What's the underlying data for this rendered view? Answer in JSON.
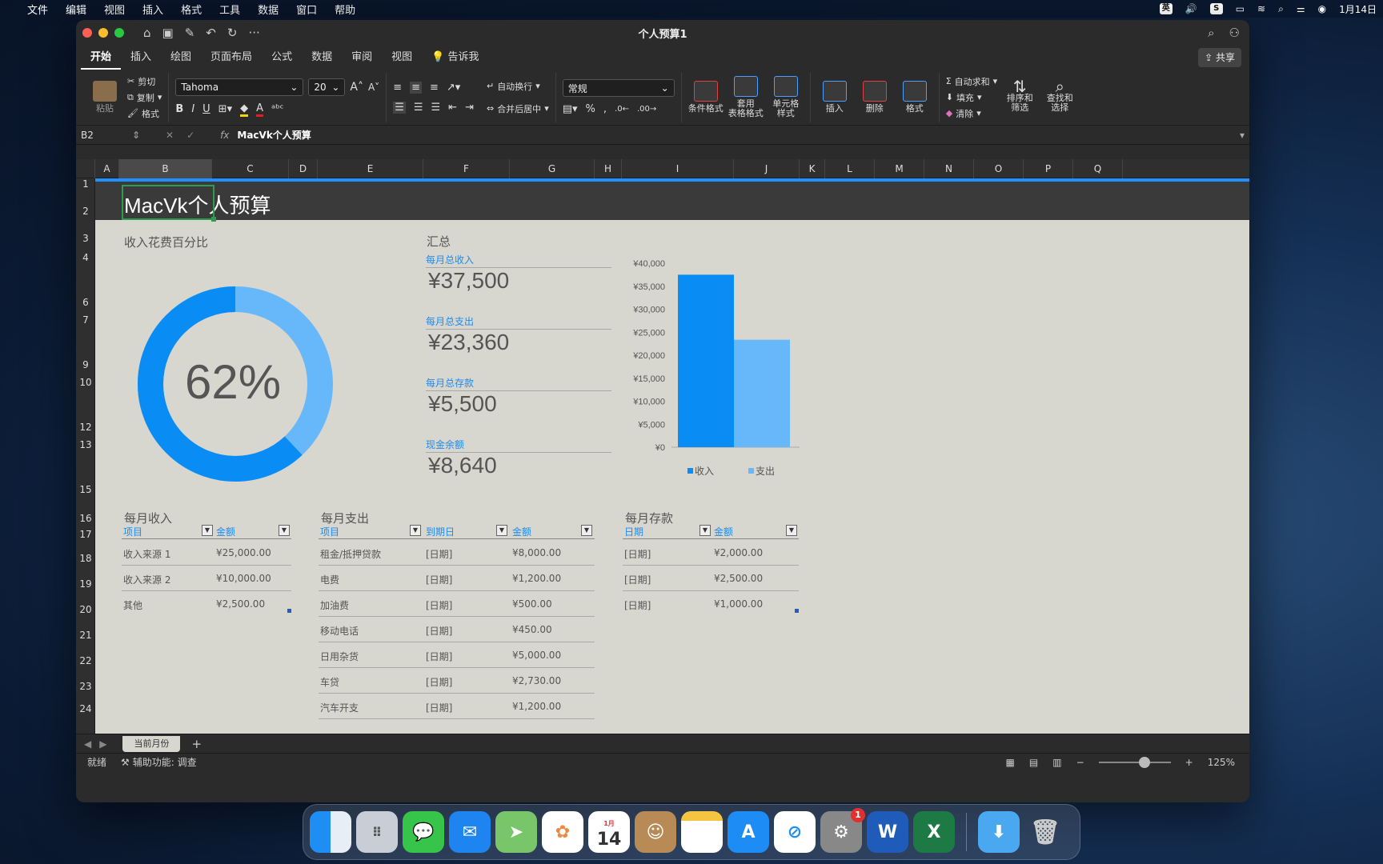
{
  "menubar": {
    "items": [
      "文件",
      "编辑",
      "视图",
      "插入",
      "格式",
      "工具",
      "数据",
      "窗口",
      "帮助"
    ],
    "input_method": "英",
    "date": "1月14日"
  },
  "window": {
    "title": "个人预算1"
  },
  "tabs": [
    "开始",
    "插入",
    "绘图",
    "页面布局",
    "公式",
    "数据",
    "审阅",
    "视图"
  ],
  "tell_me": "告诉我",
  "share": "共享",
  "ribbon": {
    "paste": "粘贴",
    "cut": "剪切",
    "copy": "复制",
    "format_painter": "格式",
    "font": "Tahoma",
    "size": "20",
    "wrap": "自动换行",
    "merge": "合并后居中",
    "number_format": "常规",
    "cond_format": "条件格式",
    "table_format": "套用\n表格格式",
    "cell_style": "单元格\n样式",
    "insert": "插入",
    "delete": "删除",
    "format": "格式",
    "autosum": "自动求和",
    "fill": "填充",
    "clear": "清除",
    "sort": "排序和\n筛选",
    "find": "查找和\n选择"
  },
  "formula": {
    "cell": "B2",
    "content": "MacVk个人预算"
  },
  "columns": [
    "A",
    "B",
    "C",
    "D",
    "E",
    "F",
    "G",
    "H",
    "I",
    "J",
    "K",
    "L",
    "M",
    "N",
    "O",
    "P",
    "Q"
  ],
  "rows": [
    "1",
    "2",
    "3",
    "4",
    "6",
    "7",
    "9",
    "10",
    "12",
    "13",
    "15",
    "16",
    "17",
    "18",
    "19",
    "20",
    "21",
    "22",
    "23",
    "24"
  ],
  "sheet": {
    "title": "MacVk个人预算",
    "pie_title": "收入花费百分比",
    "percent": "62%",
    "percent_value": 62,
    "summary_title": "汇总",
    "summary": [
      {
        "label": "每月总收入",
        "value": "¥37,500"
      },
      {
        "label": "每月总支出",
        "value": "¥23,360"
      },
      {
        "label": "每月总存款",
        "value": "¥5,500"
      },
      {
        "label": "现金余额",
        "value": "¥8,640"
      }
    ],
    "income": {
      "title": "每月收入",
      "headers": [
        "项目",
        "金额"
      ],
      "rows": [
        [
          "收入来源 1",
          "¥25,000.00"
        ],
        [
          "收入来源 2",
          "¥10,000.00"
        ],
        [
          "其他",
          "¥2,500.00"
        ]
      ]
    },
    "expense": {
      "title": "每月支出",
      "headers": [
        "项目",
        "到期日",
        "金额"
      ],
      "rows": [
        [
          "租金/抵押贷款",
          "[日期]",
          "¥8,000.00"
        ],
        [
          "电费",
          "[日期]",
          "¥1,200.00"
        ],
        [
          "加油费",
          "[日期]",
          "¥500.00"
        ],
        [
          "移动电话",
          "[日期]",
          "¥450.00"
        ],
        [
          "日用杂货",
          "[日期]",
          "¥5,000.00"
        ],
        [
          "车贷",
          "[日期]",
          "¥2,730.00"
        ],
        [
          "汽车开支",
          "[日期]",
          "¥1,200.00"
        ]
      ]
    },
    "savings": {
      "title": "每月存款",
      "headers": [
        "日期",
        "金额"
      ],
      "rows": [
        [
          "[日期]",
          "¥2,000.00"
        ],
        [
          "[日期]",
          "¥2,500.00"
        ],
        [
          "[日期]",
          "¥1,000.00"
        ]
      ]
    }
  },
  "chart_data": {
    "type": "bar",
    "categories": [
      ""
    ],
    "series": [
      {
        "name": "收入",
        "values": [
          37500
        ],
        "color": "#0a8cf5"
      },
      {
        "name": "支出",
        "values": [
          23360
        ],
        "color": "#66b8fb"
      }
    ],
    "ylim": [
      0,
      40000
    ],
    "yticks": [
      "¥0",
      "¥5,000",
      "¥10,000",
      "¥15,000",
      "¥20,000",
      "¥25,000",
      "¥30,000",
      "¥35,000",
      "¥40,000"
    ],
    "legend": "bottom"
  },
  "sheet_tab": "当前月份",
  "status": {
    "ready": "就绪",
    "accessibility": "辅助功能: 调查",
    "zoom": "125%"
  },
  "dock": {
    "calendar_month": "1月",
    "calendar_day": "14",
    "settings_badge": "1"
  }
}
